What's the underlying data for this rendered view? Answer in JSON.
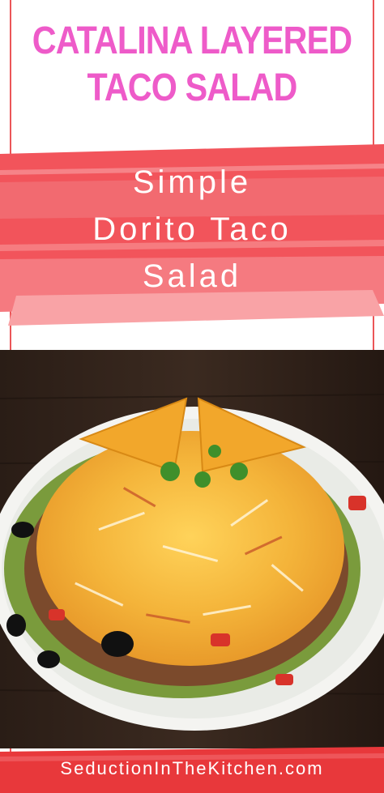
{
  "title_line1": "CATALINA LAYERED",
  "title_line2": "TACO SALAD",
  "subtitle_line1": "Simple",
  "subtitle_line2": "Dorito Taco",
  "subtitle_line3": "Salad",
  "footer": "SeductionInTheKitchen.com",
  "colors": {
    "title": "#ee5bc9",
    "brush": "#f2545b",
    "accent_red": "#e8383b",
    "cheese": "#f6b21f"
  }
}
